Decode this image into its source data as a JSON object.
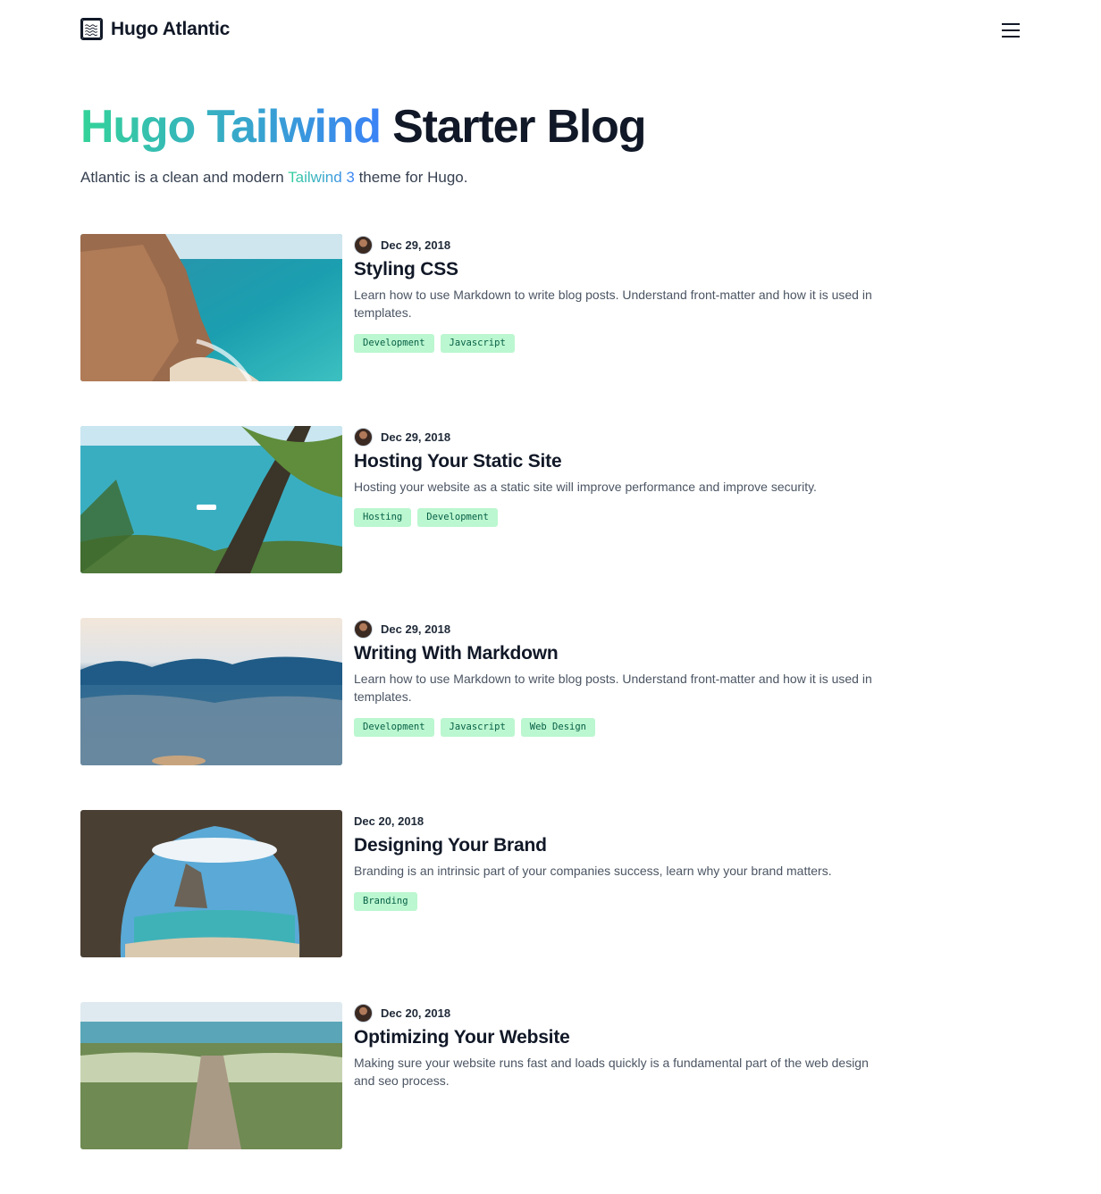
{
  "header": {
    "site_name": "Hugo Atlantic",
    "logo_icon": "waves-icon",
    "menu_icon": "hamburger-menu-icon"
  },
  "hero": {
    "title_highlight": "Hugo Tailwind",
    "title_rest": "Starter Blog",
    "subtitle_before": "Atlantic is a clean and modern",
    "subtitle_link": "Tailwind 3",
    "subtitle_after": "theme for Hugo.",
    "gradient_colors": [
      "#34d399",
      "#3b82f6"
    ]
  },
  "posts": [
    {
      "date": "Dec 29, 2018",
      "title": "Styling CSS",
      "description": "Learn how to use Markdown to write blog posts. Understand front-matter and how it is used in templates.",
      "tags": [
        "Development",
        "Javascript"
      ],
      "has_avatar": true
    },
    {
      "date": "Dec 29, 2018",
      "title": "Hosting Your Static Site",
      "description": "Hosting your website as a static site will improve performance and improve security.",
      "tags": [
        "Hosting",
        "Development"
      ],
      "has_avatar": true
    },
    {
      "date": "Dec 29, 2018",
      "title": "Writing With Markdown",
      "description": "Learn how to use Markdown to write blog posts. Understand front-matter and how it is used in templates.",
      "tags": [
        "Development",
        "Javascript",
        "Web Design"
      ],
      "has_avatar": true
    },
    {
      "date": "Dec 20, 2018",
      "title": "Designing Your Brand",
      "description": "Branding is an intrinsic part of your companies success, learn why your brand matters.",
      "tags": [
        "Branding"
      ],
      "has_avatar": false
    },
    {
      "date": "Dec 20, 2018",
      "title": "Optimizing Your Website",
      "description": "Making sure your website runs fast and loads quickly is a fundamental part of the web design and seo process.",
      "tags": [],
      "has_avatar": true
    }
  ],
  "colors": {
    "tag_bg": "#bbf7d0",
    "tag_text": "#065f46",
    "text_primary": "#111827",
    "text_muted": "#4b5563"
  }
}
